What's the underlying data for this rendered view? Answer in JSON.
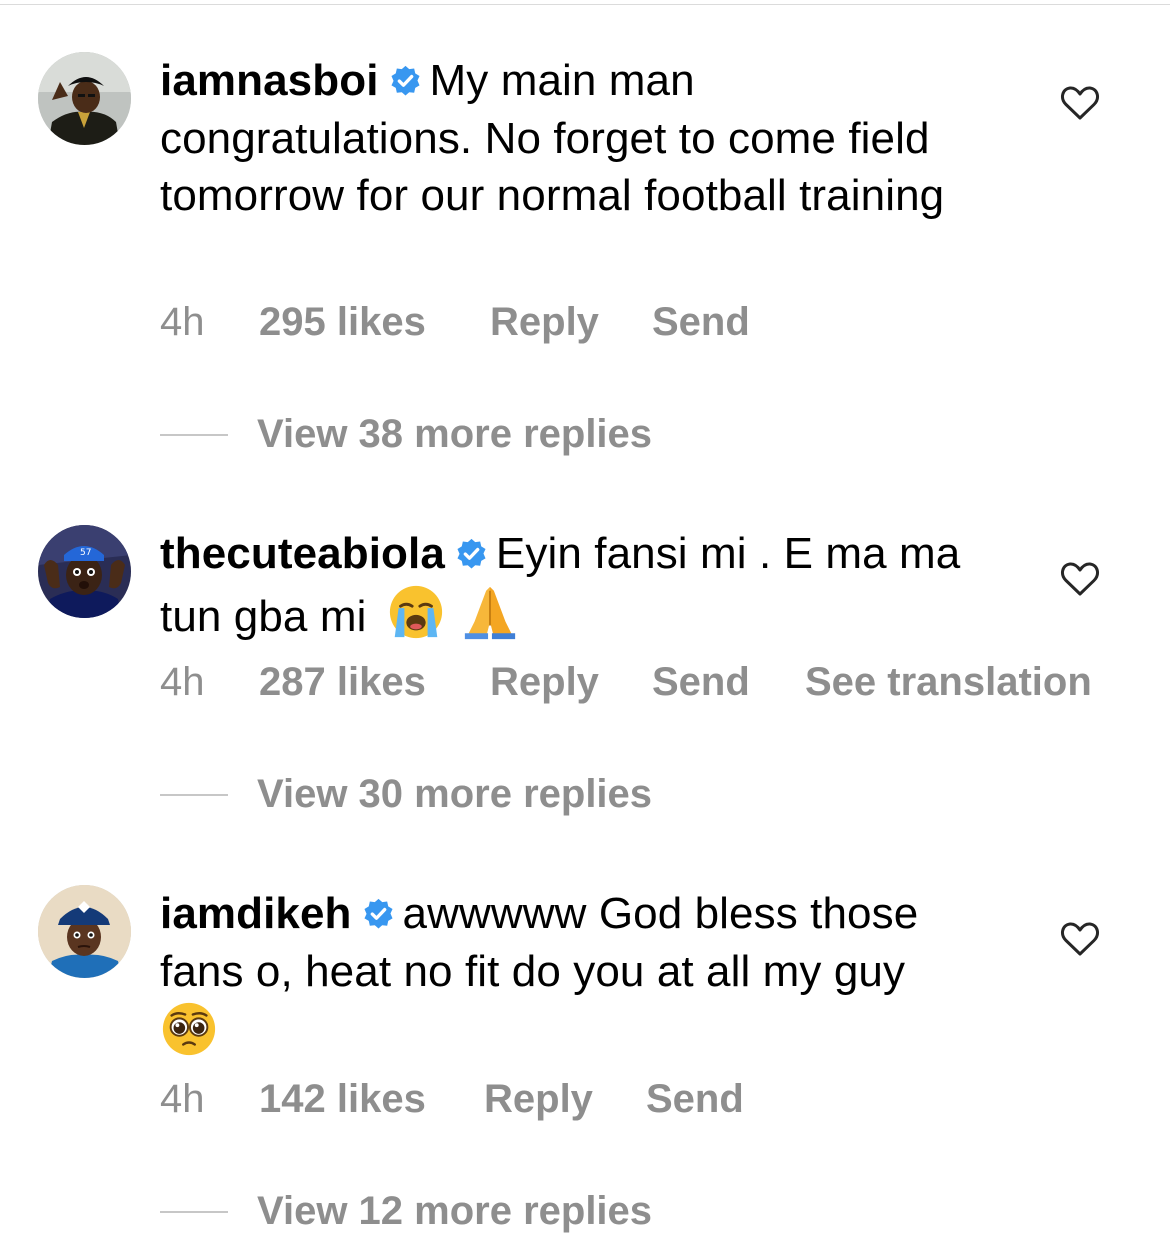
{
  "comments": [
    {
      "username": "iamnasboi",
      "verified": true,
      "text": "My main man congratulations. No forget to come field tomorrow for our normal football training",
      "time": "4h",
      "likes": "295 likes",
      "reply": "Reply",
      "send": "Send",
      "view_replies": "View 38 more replies"
    },
    {
      "username": "thecuteabiola",
      "verified": true,
      "text": "Eyin fansi mi . E ma ma tun gba mi",
      "emojis": [
        "loudly-crying-face-emoji",
        "folded-hands-emoji"
      ],
      "time": "4h",
      "likes": "287 likes",
      "reply": "Reply",
      "send": "Send",
      "see_translation": "See translation",
      "view_replies": "View 30 more replies"
    },
    {
      "username": "iamdikeh",
      "verified": true,
      "text": "awwwww God bless those fans o, heat no fit do you at all my guy",
      "emojis": [
        "pleading-face-emoji"
      ],
      "time": "4h",
      "likes": "142 likes",
      "reply": "Reply",
      "send": "Send",
      "view_replies": "View 12 more replies"
    }
  ],
  "colors": {
    "text": "#000000",
    "meta": "#8e8e8e",
    "verified": "#3897f0",
    "divider": "#c7c7c7"
  },
  "icons": {
    "verified": "verified-badge-icon",
    "like": "heart-outline-icon"
  }
}
